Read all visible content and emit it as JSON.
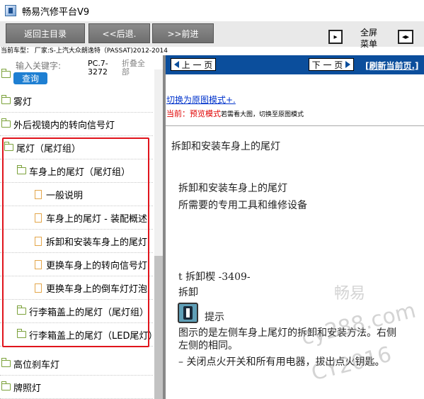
{
  "window": {
    "title": "畅易汽修平台V9"
  },
  "toolbar": {
    "home_label": "返回主目录",
    "back_label": "<<后退.",
    "forward_label": ">>前进",
    "fullscreen_label": "全屏",
    "menu_label": "菜单",
    "left_icon_glyph": "▸",
    "right_icon_glyph": "◂▸"
  },
  "model_line": "当前车型： 厂家:S-上汽大众朗逸特（PASSAT)2012-2014",
  "search": {
    "keyword_label": "输入关键字:",
    "query_label": "查询",
    "pc_code": "PC.7-3272",
    "collapse_label": "折叠全部"
  },
  "tree": [
    {
      "label": "雾灯",
      "type": "folder"
    },
    {
      "label": "外后视镜内的转向信号灯",
      "type": "folder"
    },
    {
      "label": "尾灯（尾灯组）",
      "type": "folder"
    },
    {
      "label": "车身上的尾灯（尾灯组）",
      "type": "folder"
    },
    {
      "label": "一般说明",
      "type": "doc"
    },
    {
      "label": "车身上的尾灯 - 装配概述",
      "type": "doc"
    },
    {
      "label": "拆卸和安装车身上的尾灯",
      "type": "doc"
    },
    {
      "label": "更换车身上的转向信号灯",
      "type": "doc"
    },
    {
      "label": "更换车身上的倒车灯灯泡",
      "type": "doc"
    },
    {
      "label": "行李箱盖上的尾灯（尾灯组）",
      "type": "folder"
    },
    {
      "label": "行李箱盖上的尾灯（LED尾灯）",
      "type": "folder"
    },
    {
      "label": "高位刹车灯",
      "type": "folder"
    },
    {
      "label": "牌照灯",
      "type": "folder"
    }
  ],
  "nav": {
    "prev_label": "上 一 页",
    "next_label": "下 一 页",
    "refresh_label": "[刷新当前页.]"
  },
  "mode": {
    "switch_link": "切换为原图模式+.",
    "current_prefix": "当前：",
    "current_mode": "预览模式",
    "hint": "若需看大图，切换至原图模式"
  },
  "content": {
    "heading": "拆卸和安装车身上的尾灯",
    "title": "拆卸和安装车身上的尾灯",
    "tools_line": "所需要的专用工具和维修设备",
    "tool_item": "t  拆卸楔 -3409-",
    "section": "拆卸",
    "note_label": "提示",
    "note_text_1": "图示的是左侧车身上尾灯的拆卸和安装方法。右侧",
    "note_text_2": "左侧的相同。",
    "step_1": "–  关闭点火开关和所有用电器，拔出点火钥匙。"
  },
  "watermark": {
    "line1": "畅易",
    "line2": "cy288.com",
    "line3": "CY2016"
  }
}
